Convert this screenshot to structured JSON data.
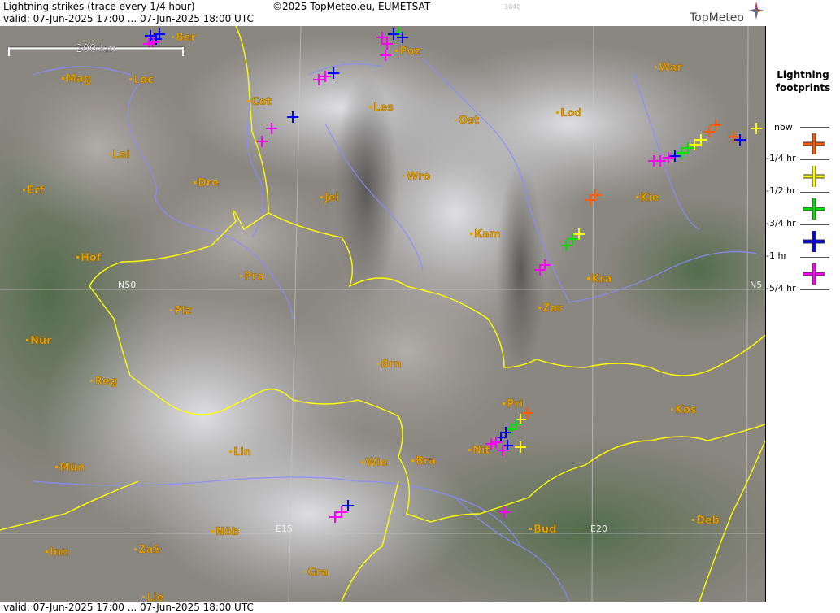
{
  "header": {
    "title": "Lightning strikes (trace every 1/4 hour)",
    "valid": "valid:  07-Jun-2025 17:00 ... 07-Jun-2025 18:00 UTC",
    "copyright": "©2025 TopMeteo.eu, EUMETSAT",
    "image_code": "3040",
    "logo": "TopMeteo"
  },
  "footer": {
    "valid": "valid:  07-Jun-2025 17:00 ... 07-Jun-2025 18:00 UTC"
  },
  "scale_bar": {
    "label": "200 km"
  },
  "grid_labels": {
    "n50": "N50",
    "n50_right": "N5",
    "e15": "E15",
    "e20": "E20"
  },
  "cities": [
    "Ber",
    "Poz",
    "War",
    "Mag",
    "Loc",
    "Cot",
    "Les",
    "Ost",
    "Lod",
    "Lei",
    "Dre",
    "Wro",
    "Erf",
    "Jel",
    "Kie",
    "Kam",
    "Hof",
    "Pra",
    "Kra",
    "Plz",
    "Zar",
    "Nür",
    "Brn",
    "Reg",
    "Pri",
    "Kos",
    "Nit",
    "Lin",
    "Wie",
    "Bra",
    "Mün",
    "Deb",
    "Bud",
    "Nöb",
    "Inn",
    "ZaS",
    "Gra",
    "Lie"
  ],
  "legend": {
    "title_line1": "Lightning",
    "title_line2": "footprints",
    "items": [
      {
        "label": "now",
        "color": ""
      },
      {
        "label": "-1/4 hr",
        "color": "#ff5a00"
      },
      {
        "label": "-1/2 hr",
        "color": "#ffff00"
      },
      {
        "label": "-3/4 hr",
        "color": "#00e000"
      },
      {
        "label": "-1 hr",
        "color": "#0000ff"
      },
      {
        "label": "-5/4 hr",
        "color": "#ff00ff"
      }
    ]
  },
  "colors": {
    "border": "#ffff00",
    "city": "#e8a000",
    "river": "#8a8cff"
  }
}
